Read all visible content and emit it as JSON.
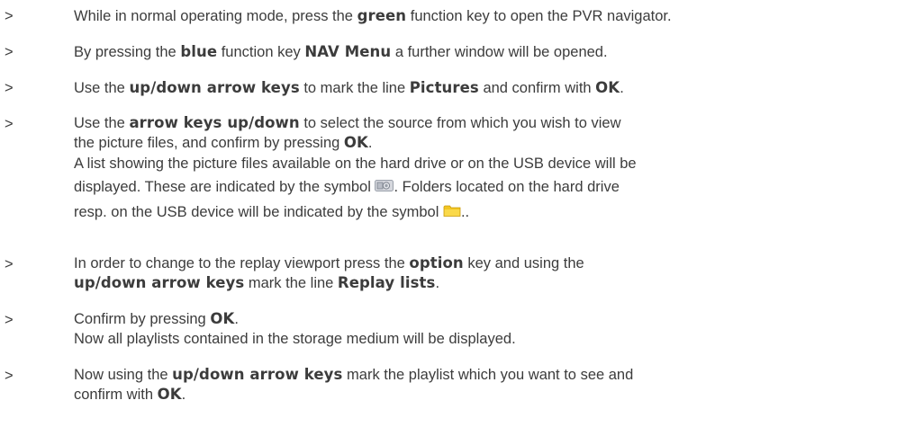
{
  "marker": ">",
  "steps": [
    {
      "t1": "While in normal operating mode, press the ",
      "k1": "green",
      "t2": " function key to open the PVR navigator."
    },
    {
      "t1": "By pressing the ",
      "k1": "blue",
      "t2": " function key ",
      "k2": "NAV Menu",
      "t3": " a further window will be opened."
    },
    {
      "t1": "Use the ",
      "k1": "up/down arrow keys",
      "t2": " to mark the line ",
      "k2": "Pictures",
      "t3": " and confirm with ",
      "k3": "OK",
      "t4": "."
    },
    {
      "t1": "Use the ",
      "k1": "arrow keys up/down",
      "t2": " to select the source from which you wish to view",
      "l2": "the picture files, and confirm by pressing ",
      "k2": "OK",
      "t3": ".",
      "l3": "A list showing the picture files available on the hard drive or on the USB device will be",
      "l4a": "displayed. These are indicated by the symbol ",
      "l4b": ". Folders located on the hard drive",
      "l5a": "resp. on the USB device will be indicated by the symbol ",
      "l5b": ".."
    },
    {
      "t1": "In order to change to the replay viewport press the ",
      "k1": "option",
      "t2": " key and using the",
      "k2": "up/down arrow keys",
      "t3": " mark the line ",
      "k3": "Replay lists",
      "t4": "."
    },
    {
      "t1": "Confirm by pressing ",
      "k1": "OK",
      "t2": ".",
      "l2": "Now all playlists contained in the storage medium will be displayed."
    },
    {
      "t1": "Now using the ",
      "k1": "up/down arrow keys",
      "t2": " mark the playlist which you want to see and",
      "l2": "confirm with ",
      "k2": "OK",
      "t3": "."
    }
  ],
  "icons": {
    "picture_symbol": "picture-file-icon",
    "folder_symbol": "folder-icon"
  }
}
